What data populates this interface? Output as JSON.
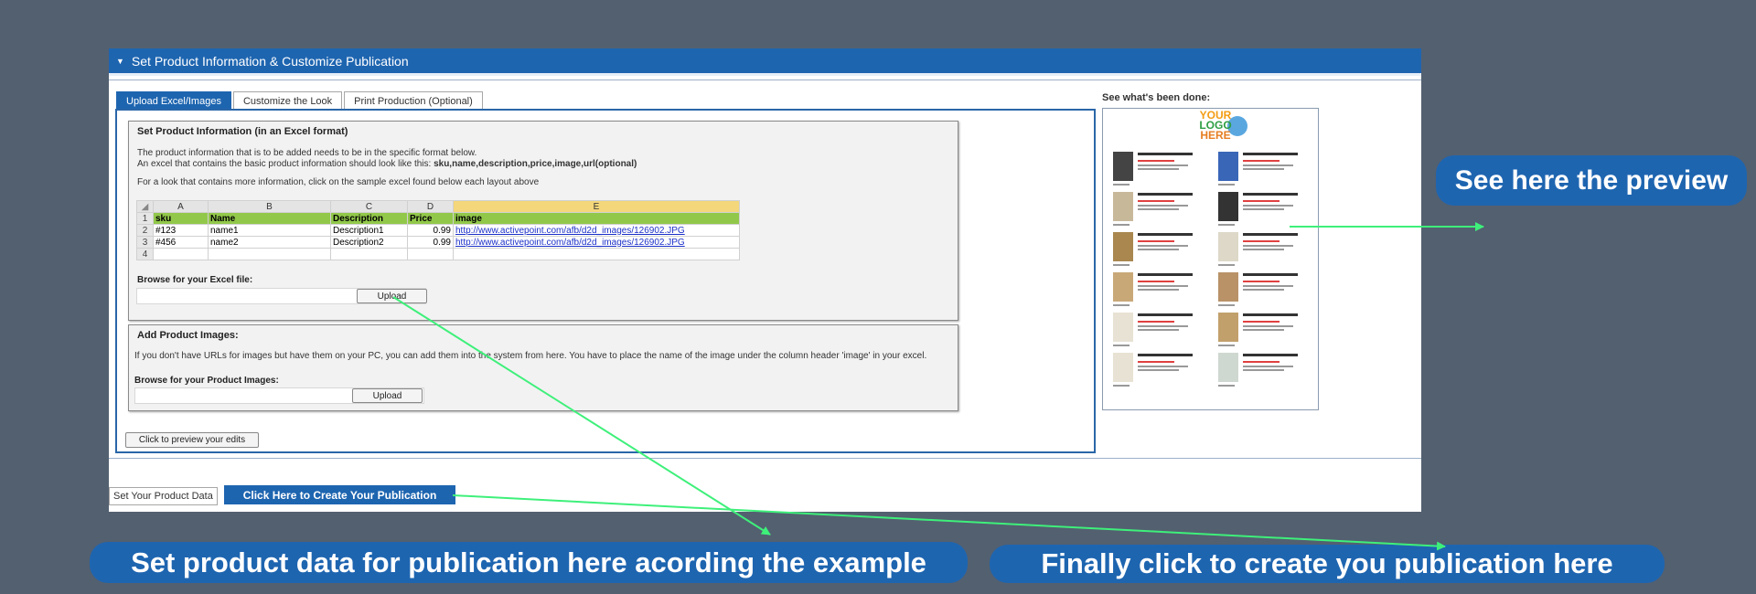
{
  "panel": {
    "title": "Set Product Information & Customize Publication"
  },
  "tabs": [
    "Upload Excel/Images",
    "Customize the Look",
    "Print Production (Optional)"
  ],
  "section1": {
    "title": "Set Product Information (in an Excel format)",
    "line1": "The product information that is to be added needs to be in the specific format below.",
    "line2_prefix": "An excel that contains the basic product information should look like this: ",
    "line2_format": "sku,name,description,price,image,url(optional)",
    "line3": "For a look that contains more information, click on the sample excel found below each layout above",
    "browse_label": "Browse for your Excel file:",
    "upload_label": "Upload"
  },
  "sheet": {
    "columns": [
      "A",
      "B",
      "C",
      "D",
      "E"
    ],
    "rows": [
      {
        "num": "1",
        "cells": [
          "sku",
          "Name",
          "Description",
          "Price",
          "image"
        ]
      },
      {
        "num": "2",
        "cells": [
          "#123",
          "name1",
          "Description1",
          "0.99",
          "http://www.activepoint.com/afb/d2d_images/126902.JPG"
        ]
      },
      {
        "num": "3",
        "cells": [
          "#456",
          "name2",
          "Description2",
          "0.99",
          "http://www.activepoint.com/afb/d2d_images/126902.JPG"
        ]
      },
      {
        "num": "4",
        "cells": [
          "",
          "",
          "",
          "",
          ""
        ]
      }
    ]
  },
  "section2": {
    "title": "Add Product Images:",
    "line1": "If you don't have URLs for images but have them on your PC, you can add them into the system from here. You have to place the name of the image under the column header 'image' in your excel.",
    "browse_label": "Browse for your Product Images:",
    "upload_label": "Upload"
  },
  "preview_edits_button": "Click to preview your edits",
  "preview": {
    "label": "See what's been done:",
    "logo_lines": [
      "YOUR",
      "LOGO",
      "HERE"
    ]
  },
  "footer": {
    "set_data_tab": "Set Your Product Data",
    "create_button": "Click Here to Create Your Publication"
  },
  "callouts": {
    "preview": "See here the preview",
    "set_data": "Set product data for publication here acording the example",
    "create": "Finally click to create you publication here"
  },
  "colors": {
    "background": "#536070",
    "accent": "#1e65b0",
    "arrow": "#3ef07a",
    "header_row": "#92c84a"
  }
}
